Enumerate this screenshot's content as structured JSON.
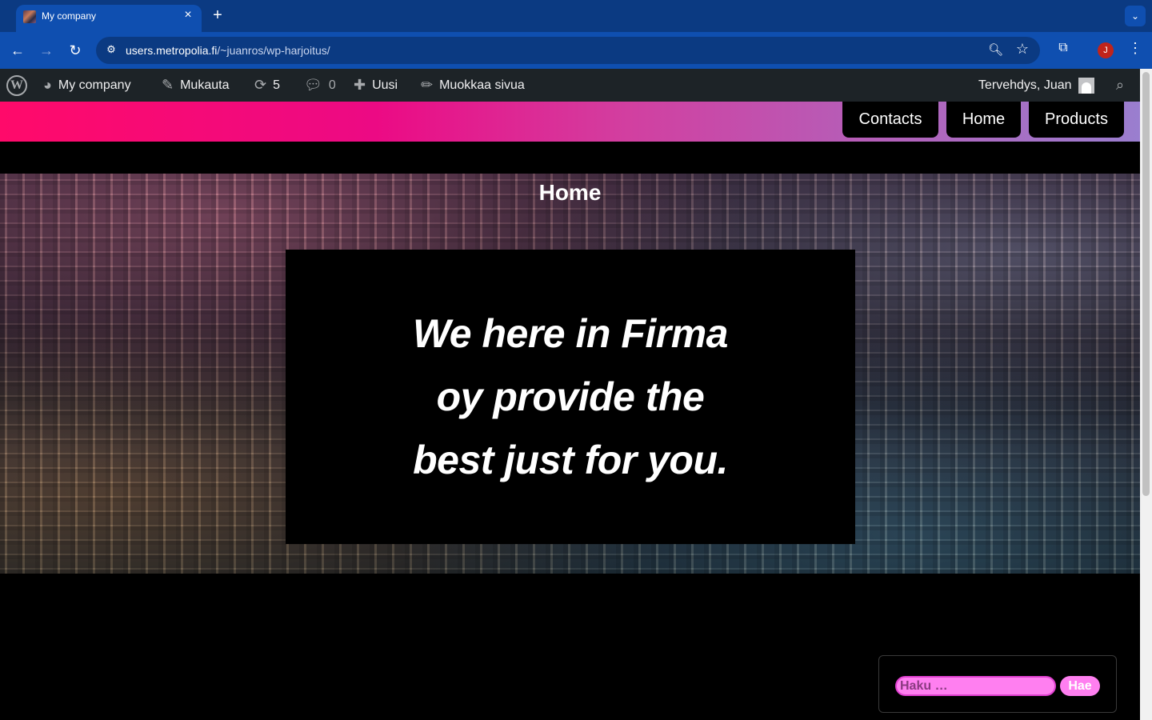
{
  "browser": {
    "tab_title": "My company",
    "new_tab_icon": "+",
    "url_host": "users.metropolia.fi",
    "url_path": "/~juanros/wp-harjoitus/",
    "profile_initial": "J"
  },
  "adminbar": {
    "site_name": "My company",
    "customize": "Mukauta",
    "updates_count": "5",
    "comments_count": "0",
    "new_label": "Uusi",
    "edit_page": "Muokkaa sivua",
    "greeting": "Tervehdys, Juan"
  },
  "site": {
    "menu": [
      "Contacts",
      "Home",
      "Products"
    ],
    "page_title": "Home",
    "hero_text": "We here in Firma oy provide the best just for you."
  },
  "search": {
    "placeholder": "Haku …",
    "button": "Hae"
  },
  "colors": {
    "header_gradient_start": "#ff0a6a",
    "header_gradient_end": "#9a7ecf",
    "search_pink": "#ff7ff0",
    "adminbar_bg": "#1d2327",
    "chrome_blue": "#0f4fb0"
  }
}
